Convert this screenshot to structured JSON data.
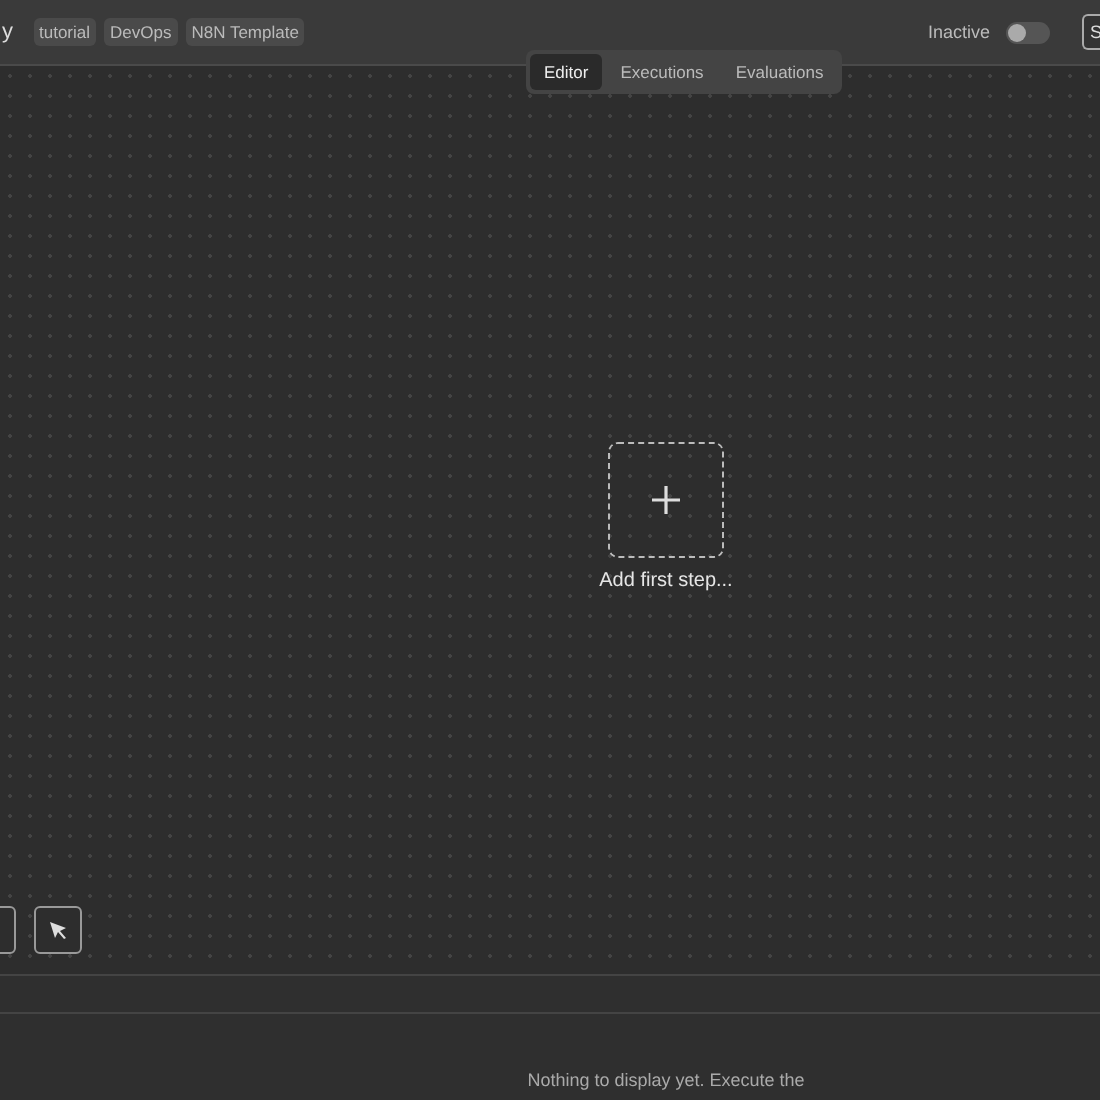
{
  "header": {
    "title": "y",
    "tags": [
      "tutorial",
      "DevOps",
      "N8N Template"
    ],
    "status": "Inactive",
    "active": false,
    "button": "S"
  },
  "tabs": [
    {
      "label": "Editor",
      "selected": true
    },
    {
      "label": "Executions",
      "selected": false
    },
    {
      "label": "Evaluations",
      "selected": false
    }
  ],
  "canvas": {
    "add_label": "Add first step..."
  },
  "logs": {
    "message": "Nothing to display yet. Execute the"
  }
}
